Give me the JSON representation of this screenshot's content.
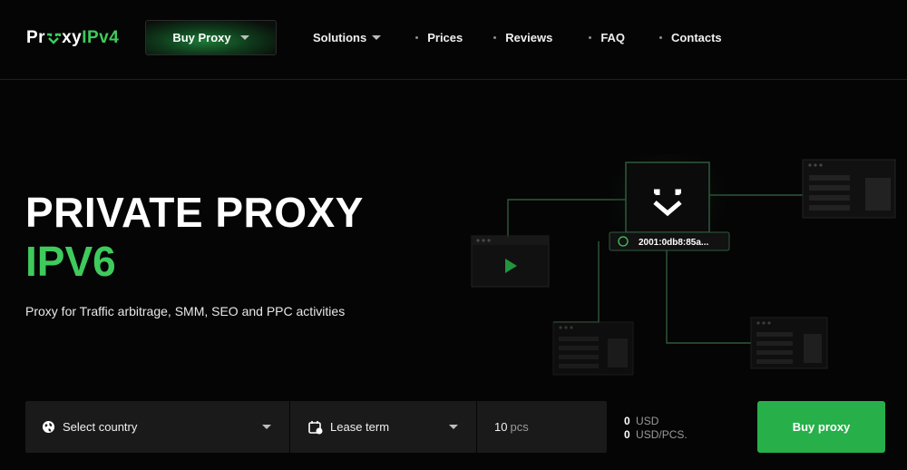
{
  "header": {
    "logo": {
      "part1": "Pr",
      "part2": "xy",
      "part3": "IPv4"
    },
    "buy_menu_label": "Buy Proxy",
    "nav": {
      "solutions": "Solutions",
      "prices": "Prices",
      "reviews": "Reviews",
      "faq": "FAQ",
      "contacts": "Contacts"
    }
  },
  "hero": {
    "title": "PRIVATE PROXY",
    "subtitle": "IPV6",
    "description": "Proxy for Traffic arbitrage, SMM, SEO and PPC activities",
    "ip_badge": "2001:0db8:85a..."
  },
  "order": {
    "country_placeholder": "Select country",
    "lease_term_placeholder": "Lease term",
    "quantity_value": "10",
    "quantity_unit": "pcs",
    "total_value": "0",
    "total_currency": "USD",
    "per_piece_value": "0",
    "per_piece_currency": "USD/PCS.",
    "buy_button": "Buy proxy"
  },
  "icons": {
    "country": "globe-icon",
    "lease": "calendar-icon",
    "dropdown": "chevron-down-icon",
    "shield": "shield-icon",
    "play": "play-icon"
  },
  "colors": {
    "accent": "#27b04a",
    "accent_text": "#3ecb5c",
    "background": "#050505",
    "panel": "#1a1a1a"
  }
}
